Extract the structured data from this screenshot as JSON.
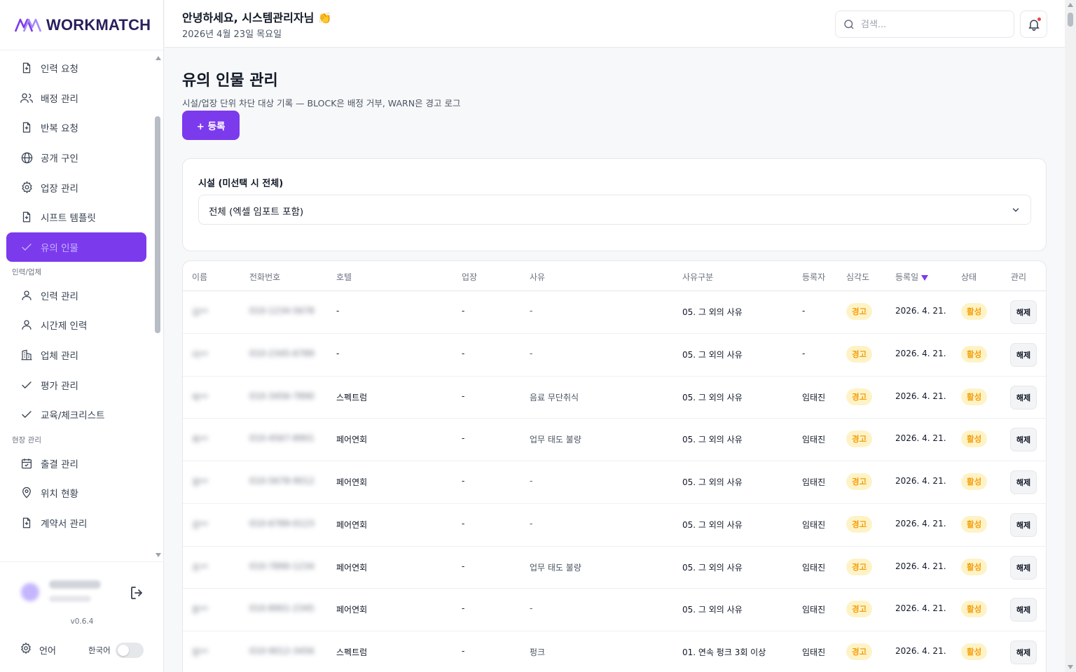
{
  "app": {
    "name": "WORKMATCH",
    "version": "v0.6.4"
  },
  "colors": {
    "accent": "#7c3aed",
    "warn_bg": "#fef3c7",
    "warn_text": "#f59e0b",
    "alert_dot": "#ef4444"
  },
  "sidebar": {
    "items_top": [
      {
        "label": "인력 요청",
        "icon": "file-plus-icon"
      },
      {
        "label": "배정 관리",
        "icon": "users-icon"
      },
      {
        "label": "반복 요청",
        "icon": "file-plus-icon"
      },
      {
        "label": "공개 구인",
        "icon": "globe-icon"
      },
      {
        "label": "업장 관리",
        "icon": "gear-icon"
      },
      {
        "label": "시프트 템플릿",
        "icon": "file-plus-icon"
      },
      {
        "label": "유의 인물",
        "icon": "check-icon",
        "active": true
      }
    ],
    "section_workforce": "인력/업체",
    "items_workforce": [
      {
        "label": "인력 관리",
        "icon": "user-icon"
      },
      {
        "label": "시간제 인력",
        "icon": "user-icon"
      },
      {
        "label": "업체 관리",
        "icon": "building-icon"
      },
      {
        "label": "평가 관리",
        "icon": "check-icon"
      },
      {
        "label": "교육/체크리스트",
        "icon": "check-icon"
      }
    ],
    "section_field": "현장 관리",
    "items_field": [
      {
        "label": "출결 관리",
        "icon": "calendar-icon"
      },
      {
        "label": "위치 현황",
        "icon": "map-pin-icon"
      },
      {
        "label": "계약서 관리",
        "icon": "file-plus-icon"
      }
    ],
    "footer": {
      "language_label": "언어",
      "language_value": "한국어"
    }
  },
  "header": {
    "greeting": "안녕하세요, 시스템관리자님 👏",
    "date": "2026년 4월 23일 목요일",
    "search_placeholder": "검색..."
  },
  "main": {
    "title": "유의 인물 관리",
    "description": "시설/업장 단위 차단 대상 기록 — BLOCK은 배정 거부, WARN은 경고 로그",
    "add_button": "+ 등록",
    "filter": {
      "label": "시설 (미선택 시 전체)",
      "selected": "전체 (엑셀 임포트 포함)"
    },
    "table": {
      "columns": [
        "이름",
        "전화번호",
        "호텔",
        "업장",
        "사유",
        "사유구분",
        "등록자",
        "심각도",
        "등록일",
        "상태",
        "관리"
      ],
      "rows": [
        {
          "name": "김**",
          "phone": "010-1234-5678",
          "hotel": "-",
          "venue": "-",
          "reason": "-",
          "category": "05. 그 외의 사유",
          "registrar": "-",
          "severity": "경고",
          "date": "2026. 4. 21.",
          "status": "활성",
          "action": "해제"
        },
        {
          "name": "이**",
          "phone": "010-2345-6789",
          "hotel": "-",
          "venue": "-",
          "reason": "-",
          "category": "05. 그 외의 사유",
          "registrar": "-",
          "severity": "경고",
          "date": "2026. 4. 21.",
          "status": "활성",
          "action": "해제"
        },
        {
          "name": "박**",
          "phone": "010-3456-7890",
          "hotel": "스펙트럼",
          "venue": "-",
          "reason": "음료 무단취식",
          "category": "05. 그 외의 사유",
          "registrar": "임태진",
          "severity": "경고",
          "date": "2026. 4. 21.",
          "status": "활성",
          "action": "해제"
        },
        {
          "name": "최**",
          "phone": "010-4567-8901",
          "hotel": "페어연회",
          "venue": "-",
          "reason": "업무 태도 불량",
          "category": "05. 그 외의 사유",
          "registrar": "임태진",
          "severity": "경고",
          "date": "2026. 4. 21.",
          "status": "활성",
          "action": "해제"
        },
        {
          "name": "정**",
          "phone": "010-5678-9012",
          "hotel": "페어연회",
          "venue": "-",
          "reason": "-",
          "category": "05. 그 외의 사유",
          "registrar": "임태진",
          "severity": "경고",
          "date": "2026. 4. 21.",
          "status": "활성",
          "action": "해제"
        },
        {
          "name": "강**",
          "phone": "010-6789-0123",
          "hotel": "페어연회",
          "venue": "-",
          "reason": "-",
          "category": "05. 그 외의 사유",
          "registrar": "임태진",
          "severity": "경고",
          "date": "2026. 4. 21.",
          "status": "활성",
          "action": "해제"
        },
        {
          "name": "조**",
          "phone": "010-7890-1234",
          "hotel": "페어연회",
          "venue": "-",
          "reason": "업무 태도 불량",
          "category": "05. 그 외의 사유",
          "registrar": "임태진",
          "severity": "경고",
          "date": "2026. 4. 21.",
          "status": "활성",
          "action": "해제"
        },
        {
          "name": "윤**",
          "phone": "010-8901-2345",
          "hotel": "페어연회",
          "venue": "-",
          "reason": "-",
          "category": "05. 그 외의 사유",
          "registrar": "임태진",
          "severity": "경고",
          "date": "2026. 4. 21.",
          "status": "활성",
          "action": "해제"
        },
        {
          "name": "장**",
          "phone": "010-9012-3456",
          "hotel": "스펙트럼",
          "venue": "-",
          "reason": "펑크",
          "category": "01. 연속 펑크 3회 이상",
          "registrar": "임태진",
          "severity": "경고",
          "date": "2026. 4. 21.",
          "status": "활성",
          "action": "해제"
        }
      ]
    }
  }
}
